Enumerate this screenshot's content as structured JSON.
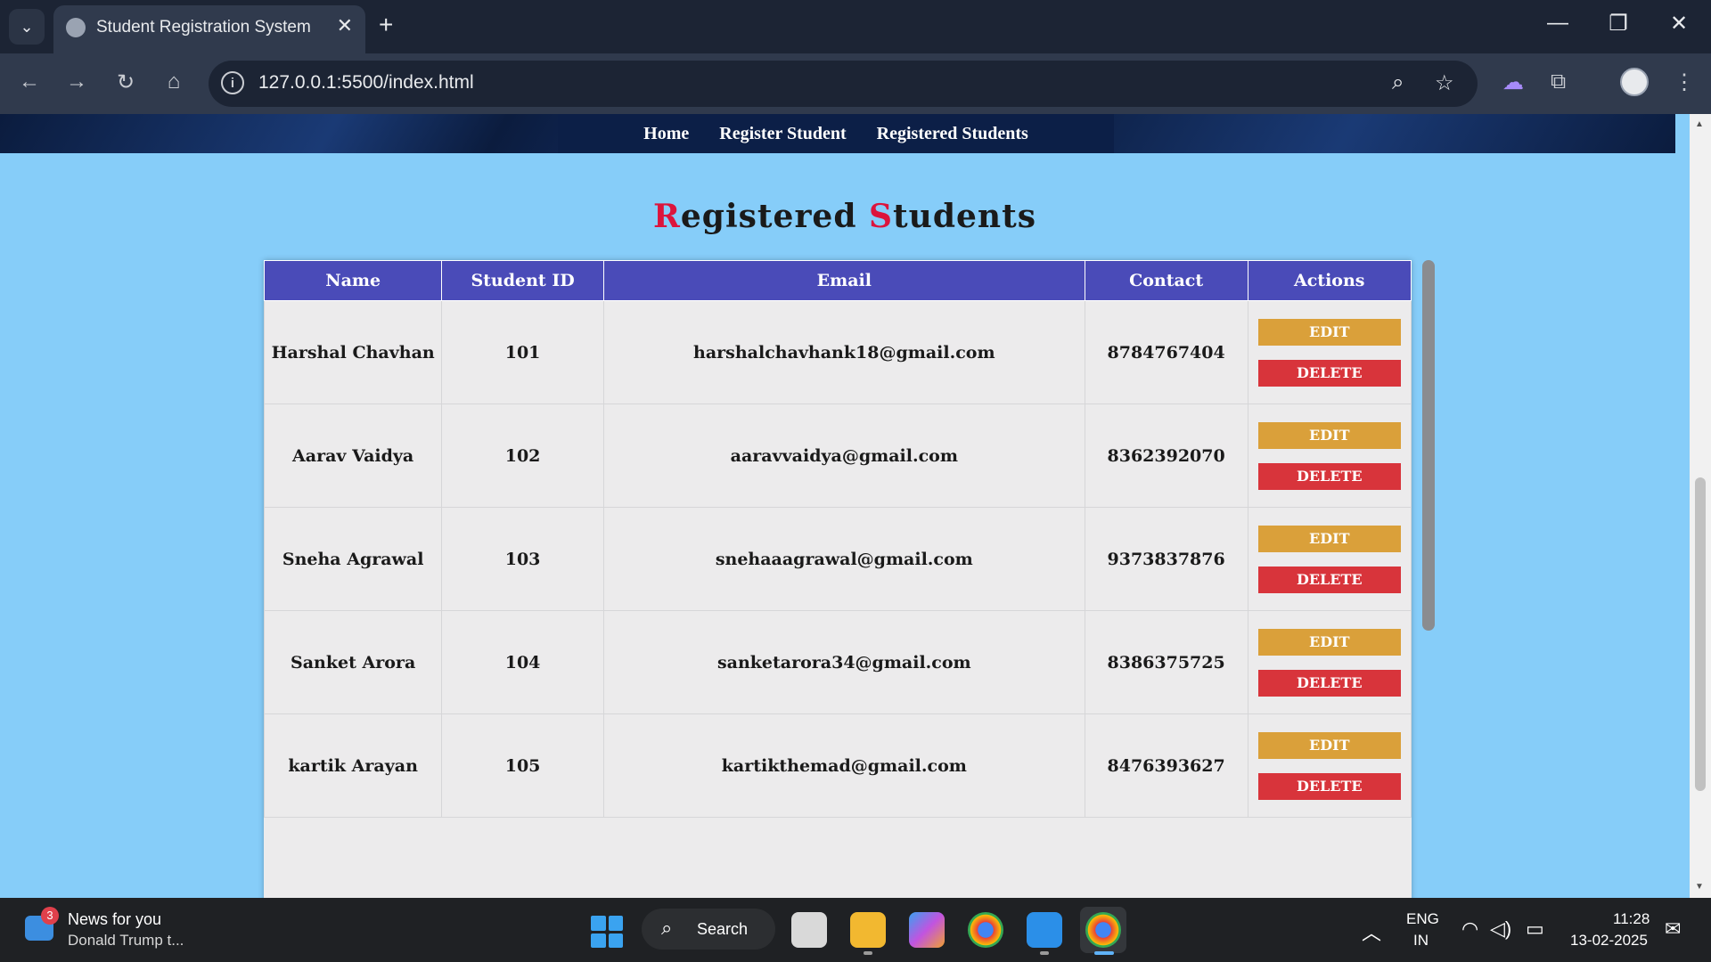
{
  "browser": {
    "tab_title": "Student Registration System",
    "url": "127.0.0.1:5500/index.html"
  },
  "page": {
    "nav": [
      "Home",
      "Register Student",
      "Registered Students"
    ],
    "heading_first_1": "R",
    "heading_rest_1": "egistered ",
    "heading_first_2": "S",
    "heading_rest_2": "tudents",
    "accent_color": "#dc143c",
    "header_color": "#4a4bb8",
    "edit_color": "#daa03a",
    "delete_color": "#d8343b",
    "table": {
      "columns": [
        "Name",
        "Student ID",
        "Email",
        "Contact",
        "Actions"
      ],
      "edit_label": "EDIT",
      "delete_label": "DELETE",
      "rows": [
        {
          "name": "Harshal Chavhan",
          "id": "101",
          "email": "harshalchavhank18@gmail.com",
          "contact": "8784767404"
        },
        {
          "name": "Aarav Vaidya",
          "id": "102",
          "email": "aaravvaidya@gmail.com",
          "contact": "8362392070"
        },
        {
          "name": "Sneha Agrawal",
          "id": "103",
          "email": "snehaaagrawal@gmail.com",
          "contact": "9373837876"
        },
        {
          "name": "Sanket Arora",
          "id": "104",
          "email": "sanketarora34@gmail.com",
          "contact": "8386375725"
        },
        {
          "name": "kartik Arayan",
          "id": "105",
          "email": "kartikthemad@gmail.com",
          "contact": "8476393627"
        }
      ]
    }
  },
  "taskbar": {
    "news_badge": "3",
    "news_title": "News for you",
    "news_sub": "Donald Trump t...",
    "search_label": "Search",
    "lang_1": "ENG",
    "lang_2": "IN",
    "time": "11:28",
    "date": "13-02-2025"
  }
}
